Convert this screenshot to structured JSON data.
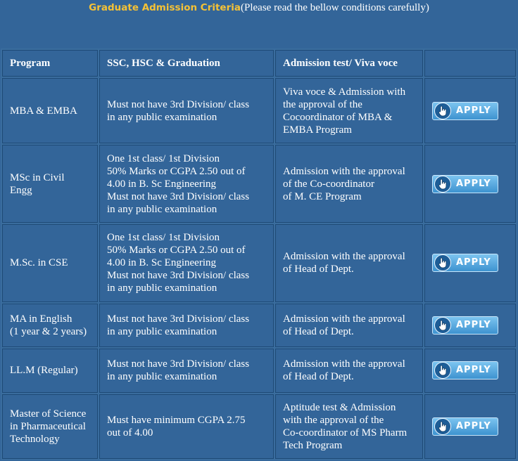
{
  "header": {
    "title": "Graduate Admission Criteria",
    "subtitle": "(Please read the bellow conditions carefully)"
  },
  "table": {
    "headers": [
      "Program",
      "SSC, HSC & Graduation",
      "Admission test/ Viva voce",
      ""
    ],
    "rows": [
      {
        "program": [
          "MBA & EMBA"
        ],
        "requirements": [
          "Must not have 3rd Division/ class",
          "in any public examination"
        ],
        "admission": [
          "Viva voce & Admission with",
          "the approval of the",
          "Cocoordinator of MBA &",
          "EMBA Program"
        ],
        "action": "APPLY"
      },
      {
        "program": [
          "MSc in Civil",
          "Engg"
        ],
        "requirements": [
          "One 1st class/ 1st Division",
          "50% Marks or CGPA 2.50 out of",
          "4.00 in B. Sc Engineering",
          "Must not have 3rd Division/ class",
          "in any public examination"
        ],
        "admission": [
          "Admission with the approval",
          "of the Co-coordinator",
          "of M. CE Program"
        ],
        "action": "APPLY"
      },
      {
        "program": [
          "M.Sc. in CSE"
        ],
        "requirements": [
          "One 1st class/ 1st Division",
          "50% Marks or CGPA 2.50 out of",
          "4.00 in B. Sc Engineering",
          "Must not have 3rd Division/ class",
          "in any public examination"
        ],
        "admission": [
          "Admission with the approval",
          "of Head of Dept."
        ],
        "action": "APPLY"
      },
      {
        "program": [
          "MA in English",
          "(1 year & 2 years)"
        ],
        "requirements": [
          "Must not have 3rd Division/ class",
          "in any public examination"
        ],
        "admission": [
          "Admission with the approval",
          "of Head of Dept."
        ],
        "action": "APPLY"
      },
      {
        "program": [
          "LL.M (Regular)"
        ],
        "requirements": [
          "Must not have 3rd Division/ class",
          "in any public examination"
        ],
        "admission": [
          "Admission with the approval",
          "of Head of Dept."
        ],
        "action": "APPLY"
      },
      {
        "program": [
          "Master of Science",
          "in Pharmaceutical",
          "Technology"
        ],
        "requirements": [
          "Must have minimum CGPA 2.75",
          "out of 4.00"
        ],
        "admission": [
          "Aptitude test & Admission",
          "with the approval of the",
          "Co-coordinator of MS Pharm",
          "Tech Program"
        ],
        "action": "APPLY"
      }
    ]
  },
  "colors": {
    "background": "#336599",
    "title_accent": "#f5c236",
    "cell_border": "#1e4a76",
    "button_top": "#7cc4f0",
    "button_bottom": "#3d93d0"
  },
  "icons": {
    "apply_button": "pointing-hand-icon"
  }
}
